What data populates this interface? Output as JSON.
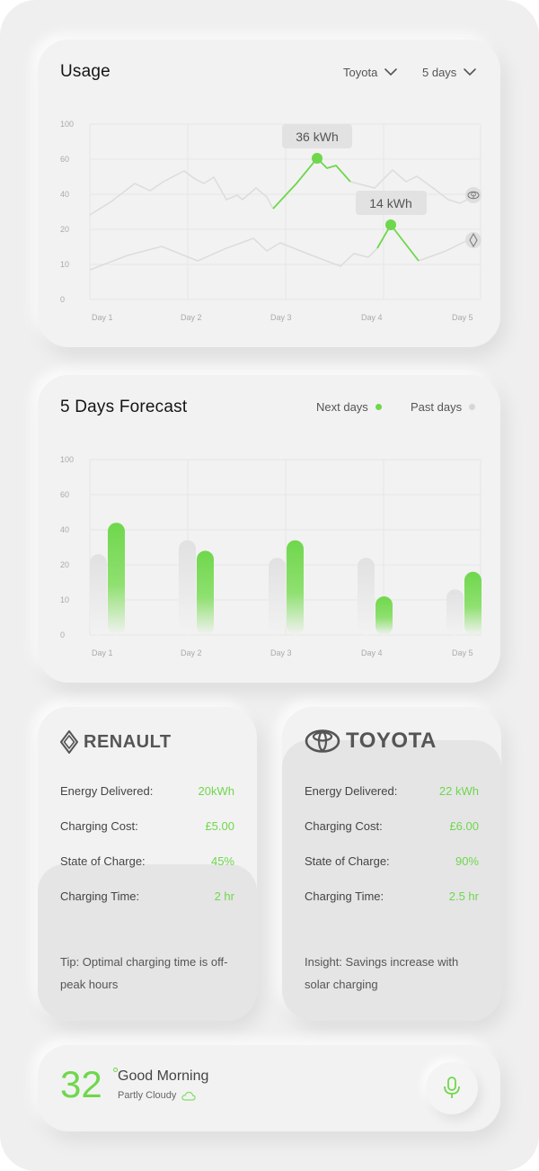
{
  "usage": {
    "title": "Usage",
    "vehicle_dropdown": "Toyota",
    "range_dropdown": "5 days",
    "tooltip_top": "36 kWh",
    "tooltip_bottom": "14 kWh",
    "y_ticks": [
      "100",
      "60",
      "40",
      "20",
      "10",
      "0"
    ],
    "x_ticks": [
      "Day 1",
      "Day 2",
      "Day 3",
      "Day 4",
      "Day 5"
    ]
  },
  "forecast": {
    "title": "5 Days Forecast",
    "legend_next": "Next days",
    "legend_past": "Past days",
    "y_ticks": [
      "100",
      "60",
      "40",
      "20",
      "10",
      "0"
    ],
    "x_ticks": [
      "Day 1",
      "Day 2",
      "Day 3",
      "Day 4",
      "Day 5"
    ]
  },
  "renault": {
    "brand": "RENAULT",
    "rows": [
      {
        "label": "Energy Delivered:",
        "value": "20kWh"
      },
      {
        "label": "Charging Cost:",
        "value": "£5.00"
      },
      {
        "label": "State of Charge:",
        "value": "45%"
      },
      {
        "label": "Charging Time:",
        "value": "2 hr"
      }
    ],
    "tip": "Tip: Optimal charging time is off-peak hours"
  },
  "toyota": {
    "brand": "TOYOTA",
    "rows": [
      {
        "label": "Energy Delivered:",
        "value": "22 kWh"
      },
      {
        "label": "Charging Cost:",
        "value": "£6.00"
      },
      {
        "label": "State of Charge:",
        "value": "90%"
      },
      {
        "label": "Charging Time:",
        "value": "2.5 hr"
      }
    ],
    "tip": "Insight: Savings increase with solar charging"
  },
  "weather": {
    "temp": "32",
    "degree": "°",
    "greeting": "Good Morning",
    "condition": "Partly Cloudy"
  },
  "colors": {
    "accent": "#6fd74c",
    "past": "#e4e4e4"
  },
  "chart_data": [
    {
      "type": "line",
      "x": [
        "Day 1",
        "Day 2",
        "Day 3",
        "Day 4",
        "Day 5"
      ],
      "ylim": [
        0,
        100
      ],
      "y_ticks": [
        100,
        60,
        40,
        20,
        10,
        0
      ],
      "series": [
        {
          "name": "Toyota",
          "values": [
            24,
            34,
            30,
            36,
            30
          ]
        },
        {
          "name": "Renault",
          "values": [
            8,
            11,
            13,
            14,
            16
          ]
        }
      ]
    },
    {
      "type": "bar",
      "categories": [
        "Day 1",
        "Day 2",
        "Day 3",
        "Day 4",
        "Day 5"
      ],
      "ylim": [
        0,
        100
      ],
      "y_ticks": [
        100,
        60,
        40,
        20,
        10,
        0
      ],
      "series": [
        {
          "name": "Past days",
          "values": [
            23,
            27,
            22,
            22,
            13
          ]
        },
        {
          "name": "Next days",
          "values": [
            32,
            24,
            27,
            11,
            18
          ]
        }
      ]
    }
  ]
}
